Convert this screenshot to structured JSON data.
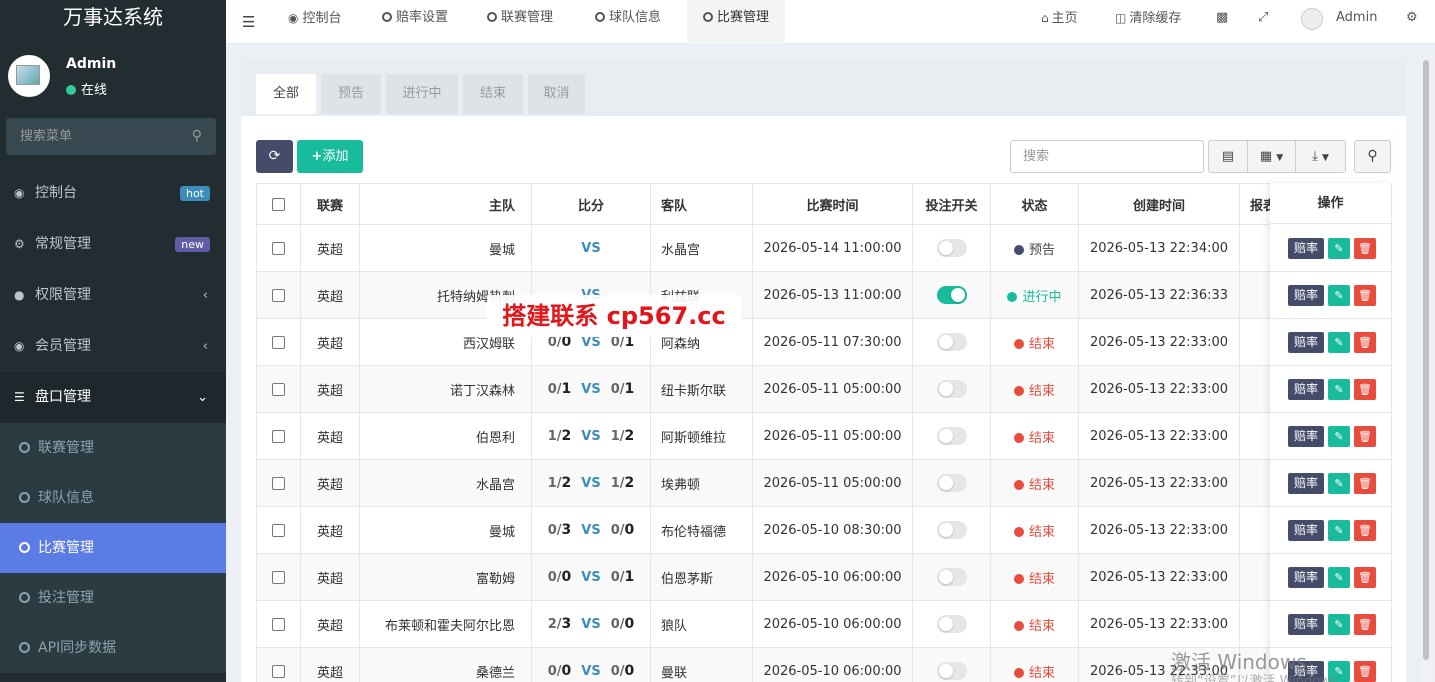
{
  "app": {
    "title": "万事达系统"
  },
  "user": {
    "name": "Admin",
    "status": "在线"
  },
  "sidebar": {
    "search_placeholder": "搜索菜单",
    "items": [
      {
        "label": "控制台",
        "badge": "hot"
      },
      {
        "label": "常规管理",
        "badge": "new"
      },
      {
        "label": "权限管理"
      },
      {
        "label": "会员管理"
      },
      {
        "label": "盘口管理"
      }
    ],
    "sub_items": [
      {
        "label": "联赛管理"
      },
      {
        "label": "球队信息"
      },
      {
        "label": "比赛管理"
      },
      {
        "label": "投注管理"
      },
      {
        "label": "API同步数据"
      }
    ]
  },
  "topbar": {
    "tabs": [
      {
        "label": "控制台"
      },
      {
        "label": "赔率设置"
      },
      {
        "label": "联赛管理"
      },
      {
        "label": "球队信息"
      },
      {
        "label": "比赛管理"
      }
    ],
    "home_label": "主页",
    "clear_cache_label": "清除缓存",
    "user_label": "Admin"
  },
  "filter_tabs": [
    {
      "label": "全部"
    },
    {
      "label": "预告"
    },
    {
      "label": "进行中"
    },
    {
      "label": "结束"
    },
    {
      "label": "取消"
    }
  ],
  "toolbar": {
    "add_label": "添加",
    "search_placeholder": "搜索"
  },
  "table": {
    "headers": {
      "league": "联赛",
      "home": "主队",
      "score": "比分",
      "away": "客队",
      "match_time": "比赛时间",
      "bet_switch": "投注开关",
      "status": "状态",
      "created": "创建时间",
      "report": "报表",
      "actions": "操作"
    },
    "rows": [
      {
        "league": "英超",
        "home": "曼城",
        "half": "",
        "full": "",
        "vs": "VS",
        "half2": "",
        "full2": "",
        "away": "水晶宫",
        "time": "2026-05-14 11:00:00",
        "bet_on": false,
        "status": "预告",
        "status_kind": "preview",
        "created": "2026-05-13 22:34:00"
      },
      {
        "league": "英超",
        "home": "托特纳姆热刺",
        "half": "",
        "full": "",
        "vs": "VS",
        "half2": "",
        "full2": "",
        "away": "利兹联",
        "time": "2026-05-13 11:00:00",
        "bet_on": true,
        "status": "进行中",
        "status_kind": "live",
        "created": "2026-05-13 22:36:33"
      },
      {
        "league": "英超",
        "home": "西汉姆联",
        "half": "0/",
        "full": "0",
        "vs": "VS",
        "half2": "0/",
        "full2": "1",
        "away": "阿森纳",
        "time": "2026-05-11 07:30:00",
        "bet_on": false,
        "status": "结束",
        "status_kind": "ended",
        "created": "2026-05-13 22:33:00"
      },
      {
        "league": "英超",
        "home": "诺丁汉森林",
        "half": "0/",
        "full": "1",
        "vs": "VS",
        "half2": "0/",
        "full2": "1",
        "away": "纽卡斯尔联",
        "time": "2026-05-11 05:00:00",
        "bet_on": false,
        "status": "结束",
        "status_kind": "ended",
        "created": "2026-05-13 22:33:00"
      },
      {
        "league": "英超",
        "home": "伯恩利",
        "half": "1/",
        "full": "2",
        "vs": "VS",
        "half2": "1/",
        "full2": "2",
        "away": "阿斯顿维拉",
        "time": "2026-05-11 05:00:00",
        "bet_on": false,
        "status": "结束",
        "status_kind": "ended",
        "created": "2026-05-13 22:33:00"
      },
      {
        "league": "英超",
        "home": "水晶宫",
        "half": "1/",
        "full": "2",
        "vs": "VS",
        "half2": "1/",
        "full2": "2",
        "away": "埃弗顿",
        "time": "2026-05-11 05:00:00",
        "bet_on": false,
        "status": "结束",
        "status_kind": "ended",
        "created": "2026-05-13 22:33:00"
      },
      {
        "league": "英超",
        "home": "曼城",
        "half": "0/",
        "full": "3",
        "vs": "VS",
        "half2": "0/",
        "full2": "0",
        "away": "布伦特福德",
        "time": "2026-05-10 08:30:00",
        "bet_on": false,
        "status": "结束",
        "status_kind": "ended",
        "created": "2026-05-13 22:33:00"
      },
      {
        "league": "英超",
        "home": "富勒姆",
        "half": "0/",
        "full": "0",
        "vs": "VS",
        "half2": "0/",
        "full2": "1",
        "away": "伯恩茅斯",
        "time": "2026-05-10 06:00:00",
        "bet_on": false,
        "status": "结束",
        "status_kind": "ended",
        "created": "2026-05-13 22:33:00"
      },
      {
        "league": "英超",
        "home": "布莱顿和霍夫阿尔比恩",
        "half": "2/",
        "full": "3",
        "vs": "VS",
        "half2": "0/",
        "full2": "0",
        "away": "狼队",
        "time": "2026-05-10 06:00:00",
        "bet_on": false,
        "status": "结束",
        "status_kind": "ended",
        "created": "2026-05-13 22:33:00"
      },
      {
        "league": "英超",
        "home": "桑德兰",
        "half": "0/",
        "full": "0",
        "vs": "VS",
        "half2": "0/",
        "full2": "0",
        "away": "曼联",
        "time": "2026-05-10 06:00:00",
        "bet_on": false,
        "status": "结束",
        "status_kind": "ended",
        "created": "2026-05-13 22:33:00"
      }
    ],
    "action_labels": {
      "odds": "赔率",
      "edit": "✎",
      "delete": "🗑"
    }
  },
  "overlay": {
    "watermark": "搭建联系 cp567.cc",
    "windows_activate": "激活 Windows",
    "windows_activate_sub": "转到“设置”以激活 Windows。"
  },
  "colors": {
    "sidebar_bg": "#222d32",
    "accent_blue": "#5b7be5",
    "primary_dark": "#444c69",
    "success": "#18bc9c",
    "danger": "#e74c3c"
  }
}
